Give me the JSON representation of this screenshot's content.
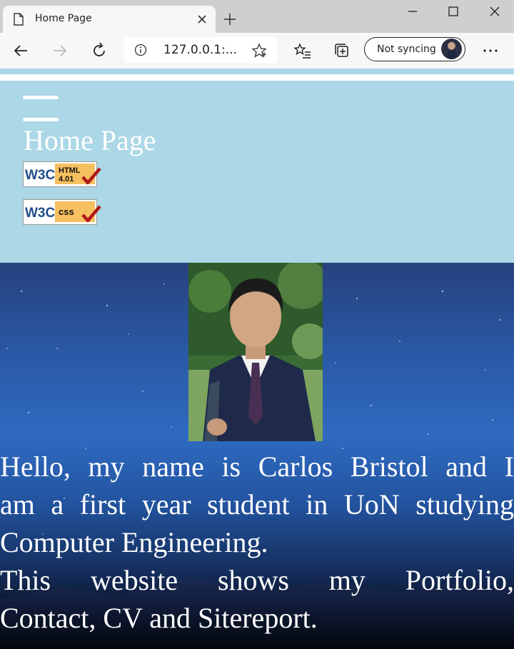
{
  "browser": {
    "tab_title": "Home Page",
    "address": "127.0.0.1:...",
    "sync_label": "Not syncing",
    "icons": {
      "tab": "page-icon",
      "tab_close": "close-icon",
      "new_tab": "plus-icon",
      "minimize": "minimize-icon",
      "maximize": "maximize-icon",
      "close_window": "close-icon",
      "back": "back-arrow-icon",
      "forward": "forward-arrow-icon",
      "refresh": "refresh-icon",
      "site_info": "info-icon",
      "favorite": "star-icon",
      "favorites": "favorites-list-icon",
      "collections": "collections-icon",
      "more": "more-icon"
    }
  },
  "page": {
    "title": "Home Page",
    "badges": [
      {
        "name": "w3c-html-4.01-badge",
        "text_left": "W3C",
        "text_right": "HTML 4.01"
      },
      {
        "name": "w3c-css-badge",
        "text_left": "W3C",
        "text_right": "css"
      }
    ],
    "intro_lines": [
      "Hello, my name is Carlos Bristol and I",
      "am a first year student in UoN studying",
      "Computer Engineering.",
      "This website shows my Portfolio,",
      "Contact, CV and Sitereport."
    ],
    "colors": {
      "header_bg": "#acd7e6",
      "text": "#ffffff",
      "hero_top": "#27427e",
      "hero_bottom": "#04070f"
    }
  }
}
